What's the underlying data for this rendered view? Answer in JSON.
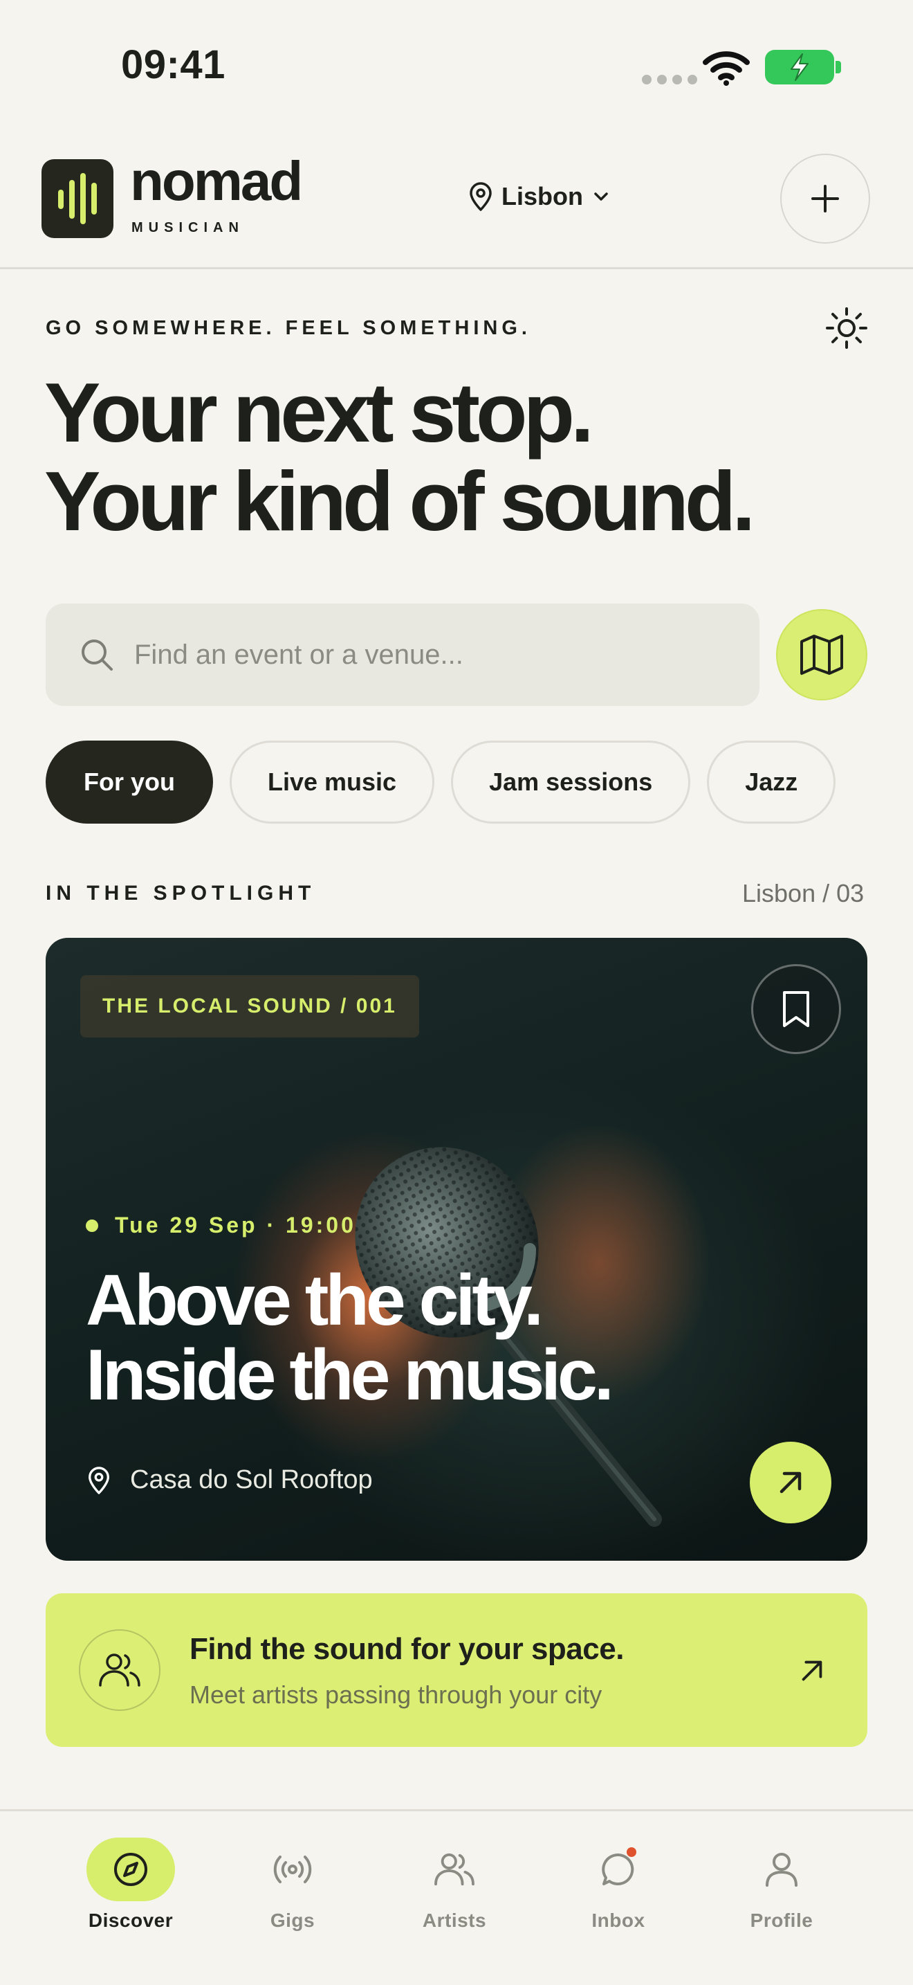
{
  "status_bar": {
    "time": "09:41"
  },
  "header": {
    "brand": "nomad",
    "brand_sub": "MUSICIAN",
    "location": "Lisbon"
  },
  "hero": {
    "tagline": "GO SOMEWHERE. FEEL SOMETHING.",
    "headline_line1": "Your next stop.",
    "headline_line2": "Your kind of sound."
  },
  "search": {
    "placeholder": "Find an event or a venue..."
  },
  "chips": [
    {
      "label": "For you",
      "active": true
    },
    {
      "label": "Live music",
      "active": false
    },
    {
      "label": "Jam sessions",
      "active": false
    },
    {
      "label": "Jazz",
      "active": false
    }
  ],
  "spotlight": {
    "title": "IN THE SPOTLIGHT",
    "meta": "Lisbon / 03",
    "card": {
      "tag": "THE LOCAL SOUND / 001",
      "date": "Tue 29 Sep · 19:00",
      "title_line1": "Above the city.",
      "title_line2": "Inside the music.",
      "venue": "Casa do Sol Rooftop"
    }
  },
  "promo": {
    "title": "Find the sound for your space.",
    "subtitle": "Meet artists passing through your city"
  },
  "nav": [
    {
      "label": "Discover",
      "icon": "compass-icon",
      "active": true
    },
    {
      "label": "Gigs",
      "icon": "broadcast-icon",
      "active": false
    },
    {
      "label": "Artists",
      "icon": "users-icon",
      "active": false
    },
    {
      "label": "Inbox",
      "icon": "chat-icon",
      "active": false,
      "badge": true
    },
    {
      "label": "Profile",
      "icon": "user-icon",
      "active": false
    }
  ],
  "colors": {
    "background": "#f5f4ef",
    "accent": "#d6ee6b",
    "dark": "#25271f",
    "badge": "#e0522e"
  }
}
